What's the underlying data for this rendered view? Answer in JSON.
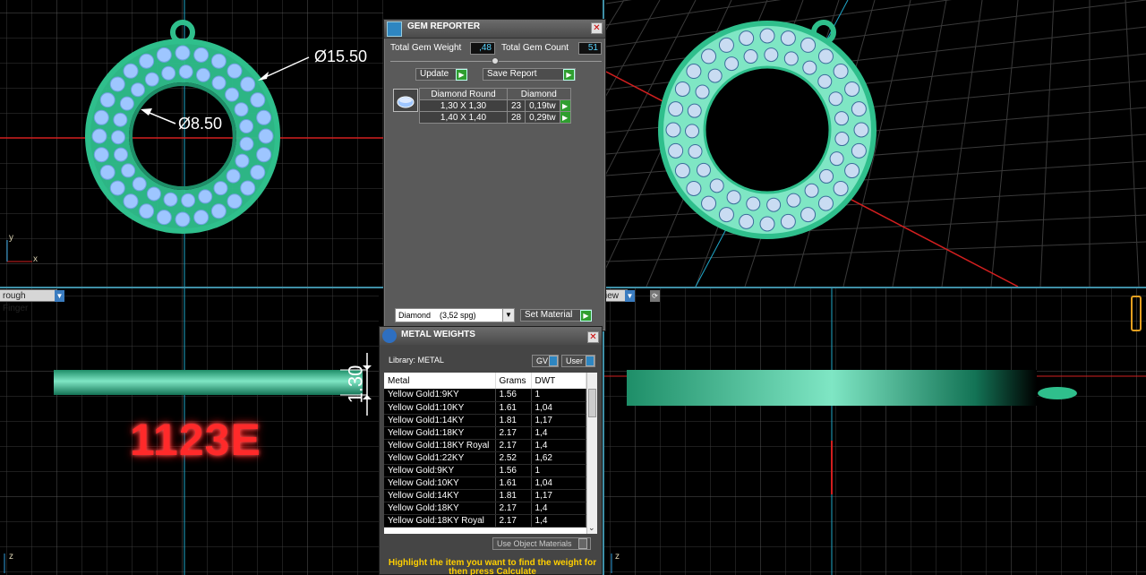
{
  "viewports": {
    "top_left": {
      "dims": {
        "outer": "Ø15.50",
        "inner": "Ø8.50"
      },
      "axes": {
        "y": "y",
        "x": "x"
      }
    },
    "bottom_left": {
      "menu_label": "rough Finger",
      "dim_vertical": "1.30",
      "code_label": "1123E",
      "axis": "z"
    },
    "bottom_right": {
      "menu_label": "iew",
      "axis": "z"
    }
  },
  "gem_reporter": {
    "title": "GEM REPORTER",
    "total_gem_weight_label": "Total Gem Weight",
    "total_gem_weight": ",48",
    "total_gem_count_label": "Total Gem Count",
    "total_gem_count": "51",
    "update_label": "Update",
    "save_report_label": "Save Report",
    "table": {
      "headers": [
        "Diamond Round",
        "Diamond"
      ],
      "rows": [
        {
          "size": "1,30 X 1,30",
          "count": "23",
          "weight": "0,19tw"
        },
        {
          "size": "1,40 X 1,40",
          "count": "28",
          "weight": "0,29tw"
        }
      ]
    },
    "material_select": "Diamond    (3,52 spg)",
    "set_material_label": "Set Material"
  },
  "metal_weights": {
    "title": "METAL WEIGHTS",
    "library_label": "Library: METAL",
    "gv_label": "GV",
    "user_label": "User",
    "columns": [
      "Metal",
      "Grams",
      "DWT"
    ],
    "rows": [
      [
        "Yellow Gold1:9KY",
        "1.56",
        "1"
      ],
      [
        "Yellow Gold1:10KY",
        "1.61",
        "1,04"
      ],
      [
        "Yellow Gold1:14KY",
        "1.81",
        "1,17"
      ],
      [
        "Yellow Gold1:18KY",
        "2.17",
        "1,4"
      ],
      [
        "Yellow Gold1:18KY Royal",
        "2.17",
        "1,4"
      ],
      [
        "Yellow Gold1:22KY",
        "2.52",
        "1,62"
      ],
      [
        "Yellow Gold:9KY",
        "1.56",
        "1"
      ],
      [
        "Yellow Gold:10KY",
        "1.61",
        "1,04"
      ],
      [
        "Yellow Gold:14KY",
        "1.81",
        "1,17"
      ],
      [
        "Yellow Gold:18KY",
        "2.17",
        "1,4"
      ],
      [
        "Yellow Gold:18KY Royal",
        "2.17",
        "1,4"
      ]
    ],
    "use_object_materials_label": "Use Object Materials",
    "hint": "Highlight the item you want to find the weight for then press Calculate"
  },
  "colors": {
    "metal": "#2fbf8c",
    "metal_light": "#7fe6c4",
    "gem": "#9ec6ff",
    "grid": "#3b3b3b",
    "axis_red": "#d21f1f",
    "axis_cyan": "#1fa7c9",
    "accent_value": "#5ad5ff"
  }
}
